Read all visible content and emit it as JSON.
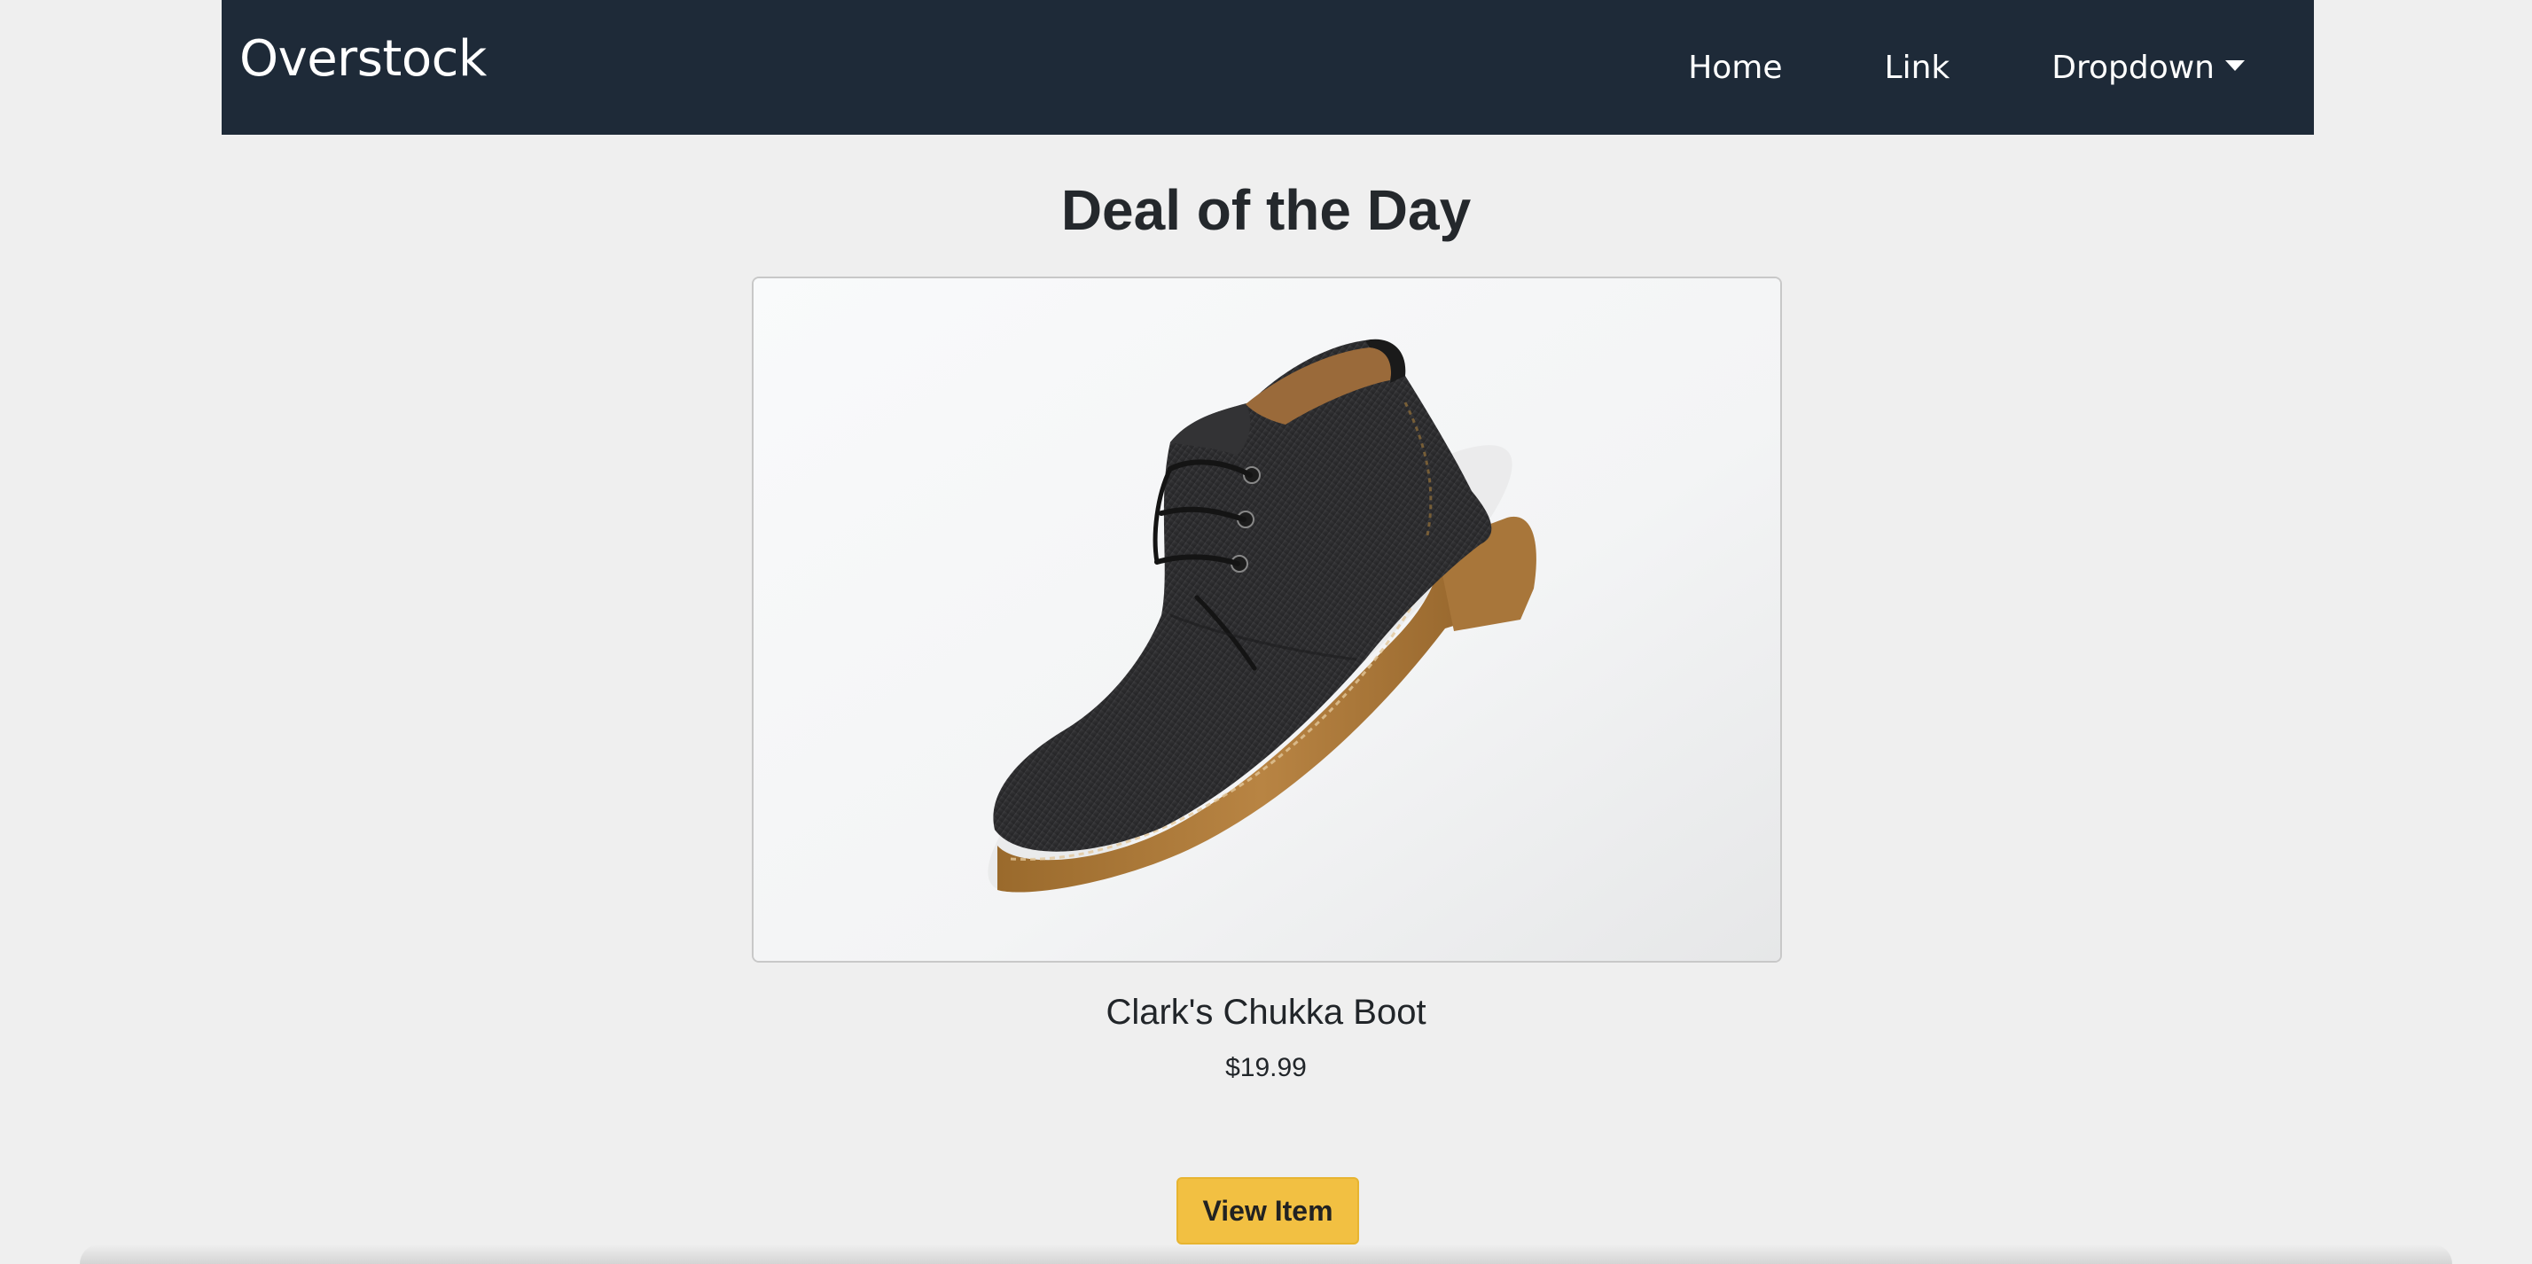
{
  "navbar": {
    "brand": "Overstock",
    "links": {
      "home": "Home",
      "link": "Link",
      "dropdown": "Dropdown"
    },
    "background_color": "#1e2a38"
  },
  "main": {
    "title": "Deal of the Day",
    "product": {
      "image_icon": "boot-image",
      "name": "Clark's Chukka Boot",
      "price": "$19.99"
    },
    "view_button_label": "View Item",
    "button_color": "#f2c042"
  }
}
